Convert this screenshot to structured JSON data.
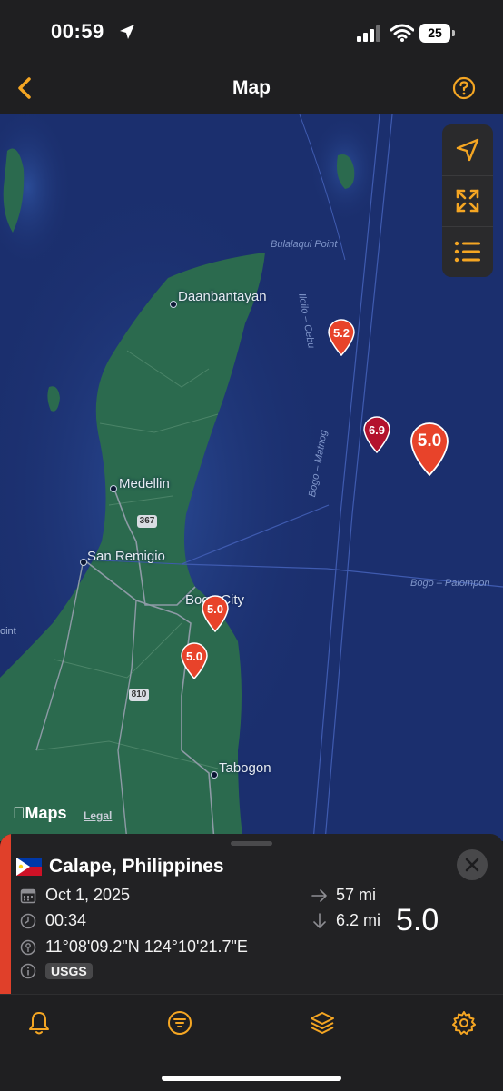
{
  "status_bar": {
    "time": "00:59",
    "battery": "25"
  },
  "nav": {
    "title": "Map"
  },
  "map": {
    "places": [
      {
        "name": "Daanbantayan"
      },
      {
        "name": "Medellin"
      },
      {
        "name": "San Remigio"
      },
      {
        "name": "Bogo City"
      },
      {
        "name": "Tabogon"
      }
    ],
    "route_labels": {
      "bulalaqui": "Bulalaqui Point",
      "iloilo_cebu": "Iloilo – Cebu",
      "bogo_matnog": "Bogo – Matnog",
      "bogo_palompon": "Bogo – Palompon",
      "edge_left": "oint"
    },
    "road_shields": [
      "367",
      "810"
    ],
    "attribution": {
      "logo": "Maps",
      "legal": "Legal"
    }
  },
  "quakes": [
    {
      "magnitude": "5.2",
      "color": "#e8432a"
    },
    {
      "magnitude": "6.9",
      "color": "#b3122d"
    },
    {
      "magnitude": "5.0",
      "color": "#e8432a"
    },
    {
      "magnitude": "5.0",
      "color": "#e8432a"
    },
    {
      "magnitude": "5.0",
      "color": "#e8432a"
    }
  ],
  "colors": {
    "accent": "#f5a623",
    "quake": "#e0402a",
    "sea": "#1b2f6e",
    "land": "#2b6a4e"
  },
  "detail": {
    "title": "Calape, Philippines",
    "date": "Oct 1, 2025",
    "time": "00:34",
    "coordinates": "11°08'09.2\"N 124°10'21.7\"E",
    "source": "USGS",
    "distance": "57 mi",
    "depth": "6.2 mi",
    "magnitude": "5.0",
    "icons": [
      "calendar-icon",
      "clock-icon",
      "location-pin-icon",
      "info-icon",
      "arrow-right-icon",
      "arrow-down-icon"
    ]
  },
  "tabs": [
    "bell-icon",
    "filter-icon",
    "layers-icon",
    "gear-icon"
  ]
}
